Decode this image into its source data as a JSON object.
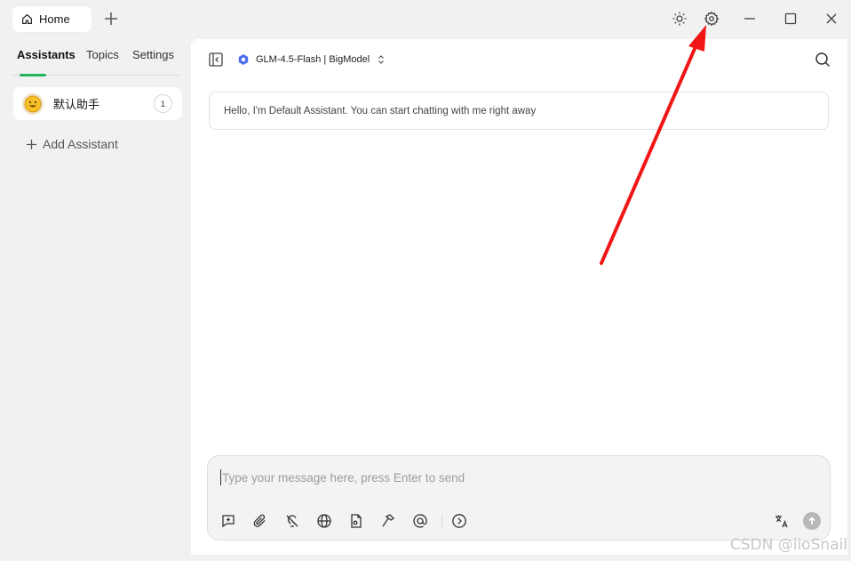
{
  "titlebar": {
    "home_tab_label": "Home",
    "icons": [
      "home-icon",
      "plus-icon",
      "sun-icon",
      "gear-icon",
      "minimize-icon",
      "maximize-icon",
      "close-icon"
    ]
  },
  "sidebar": {
    "tabs": [
      {
        "label": "Assistants",
        "active": true
      },
      {
        "label": "Topics",
        "active": false
      },
      {
        "label": "Settings",
        "active": false
      }
    ],
    "assistant": {
      "name": "默认助手",
      "count": "1",
      "avatar": "smiley-emoji"
    },
    "add_assistant_label": "Add Assistant"
  },
  "main": {
    "model_label": "GLM-4.5-Flash | BigModel",
    "greeting": "Hello, I'm Default Assistant. You can start chatting with me right away",
    "composer": {
      "value": "",
      "placeholder": "Type your message here, press Enter to send",
      "tools": [
        "new-topic-icon",
        "attachment-icon",
        "lightbulb-off-icon",
        "globe-icon",
        "knowledge-file-icon",
        "hammer-icon",
        "at-mention-icon",
        "chevron-right-circle-icon"
      ],
      "right_tools": [
        "translate-icon",
        "send-arrow-icon"
      ]
    }
  },
  "watermark": "CSDN @iioSnail",
  "colors": {
    "accent": "#23b45e",
    "annotation_arrow": "#f01616",
    "model_icon": "#4f6df0"
  }
}
